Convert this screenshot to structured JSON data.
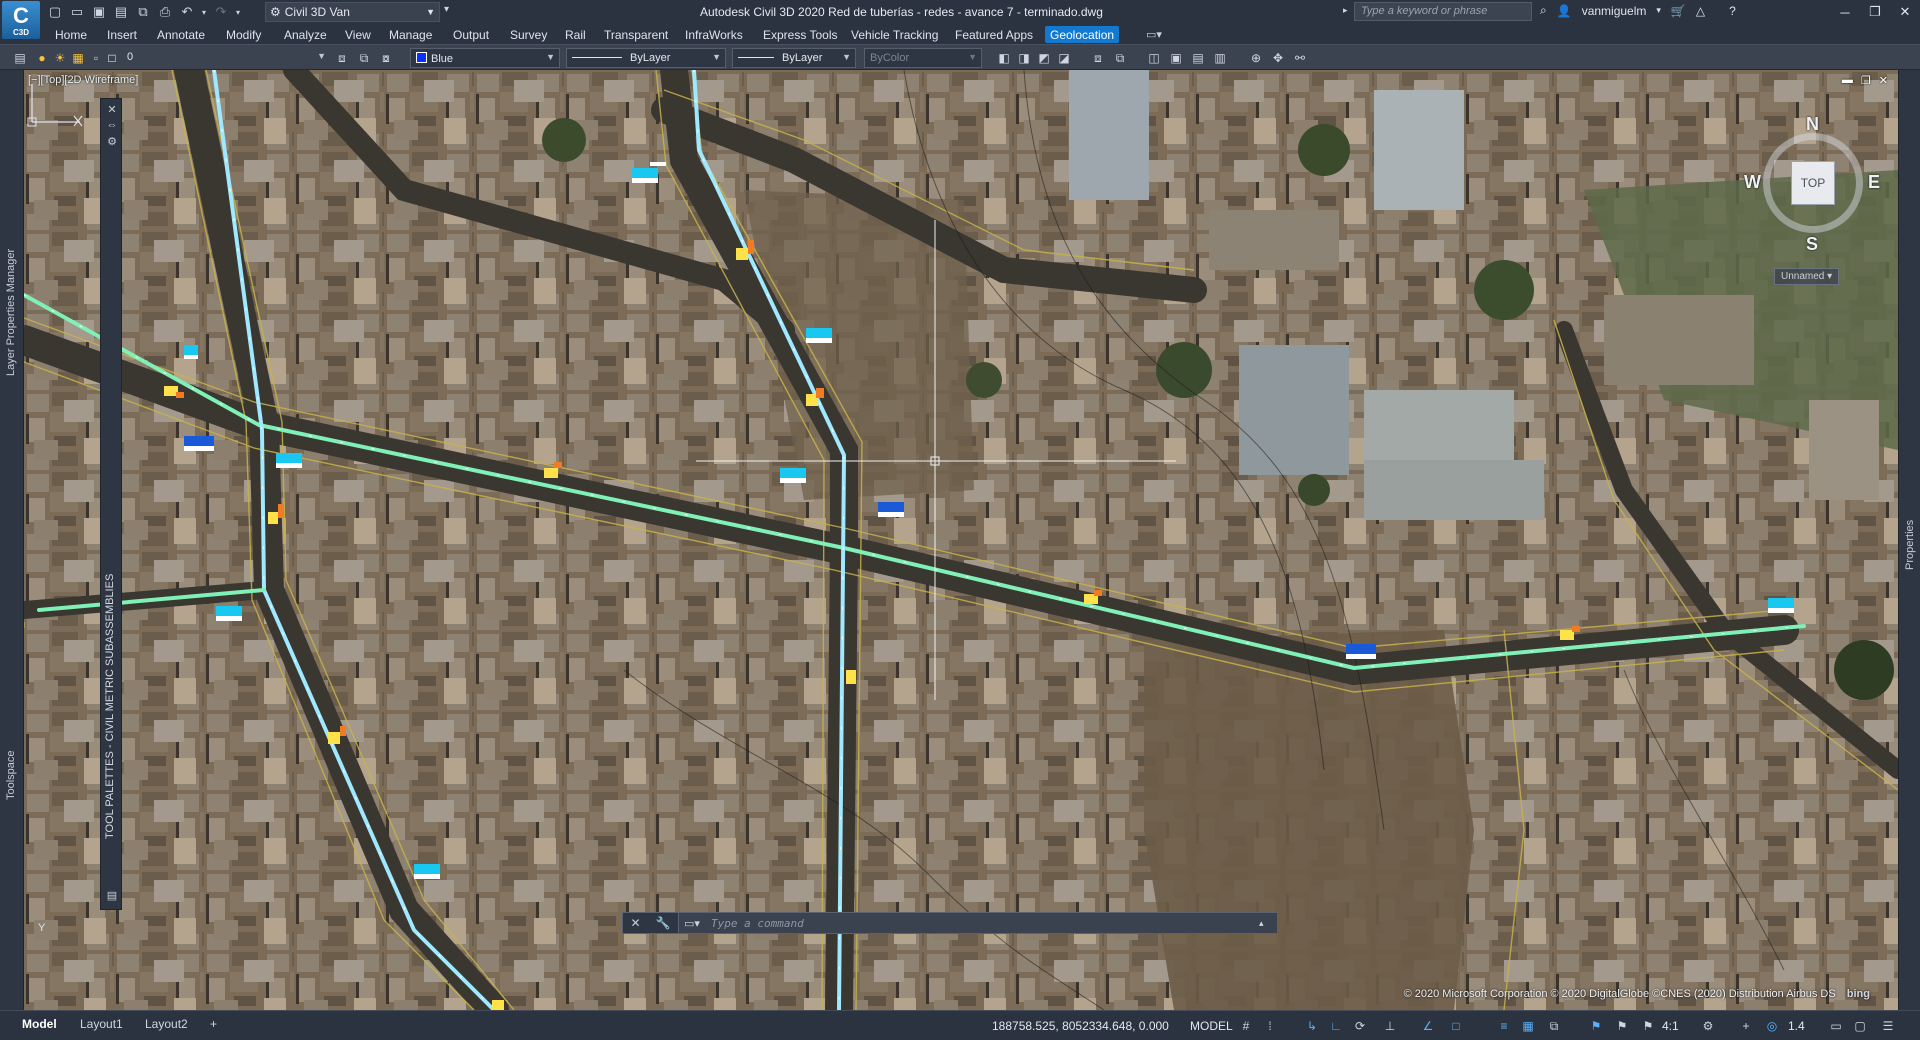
{
  "app": {
    "logo_text": "C",
    "logo_sub": "C3D",
    "title": "Autodesk Civil 3D 2020   Red de tuberías - redes - avance 7 - terminado.dwg",
    "workspace": "Civil 3D Van",
    "search_placeholder": "Type a keyword or phrase",
    "user": "vanmiguelm"
  },
  "ribbon_tabs": [
    "Home",
    "Insert",
    "Annotate",
    "Modify",
    "Analyze",
    "View",
    "Manage",
    "Output",
    "Survey",
    "Rail",
    "Transparent",
    "InfraWorks",
    "Express Tools",
    "Vehicle Tracking",
    "Featured Apps",
    "Geolocation"
  ],
  "active_tab": "Geolocation",
  "toolbar": {
    "layer_value": "0",
    "color_value": "Blue",
    "color_hex": "#0a2fff",
    "linetype_value": "ByLayer",
    "lineweight_value": "ByLayer",
    "plotstyle_value": "ByColor"
  },
  "viewport": {
    "label": "[−][Top][2D Wireframe]",
    "viewcube_face": "TOP",
    "compass_n": "N",
    "compass_s": "S",
    "compass_e": "E",
    "compass_w": "W",
    "named_view": "Unnamed",
    "ucs_y": "Y",
    "copyright": "© 2020 Microsoft Corporation © 2020 DigitalGlobe ©CNES (2020) Distribution Airbus DS",
    "bing": "bing"
  },
  "palettes": {
    "layer_properties": "Layer Properties Manager",
    "toolspace": "Toolspace",
    "tool_palettes": "TOOL PALETTES - CIVIL METRIC SUBASSEMBLIES",
    "properties": "Properties"
  },
  "command": {
    "placeholder": "Type a command"
  },
  "status": {
    "layout_tabs": [
      "Model",
      "Layout1",
      "Layout2"
    ],
    "add_tab": "+",
    "coordinates": "188758.525, 8052334.648, 0.000",
    "mode": "MODEL",
    "scale": "4:1",
    "zoom": "1.4"
  },
  "colors": {
    "pipe_blue": "#9fe8ff",
    "pipe_green": "#7ff0b6",
    "accent": "#1279d1"
  }
}
